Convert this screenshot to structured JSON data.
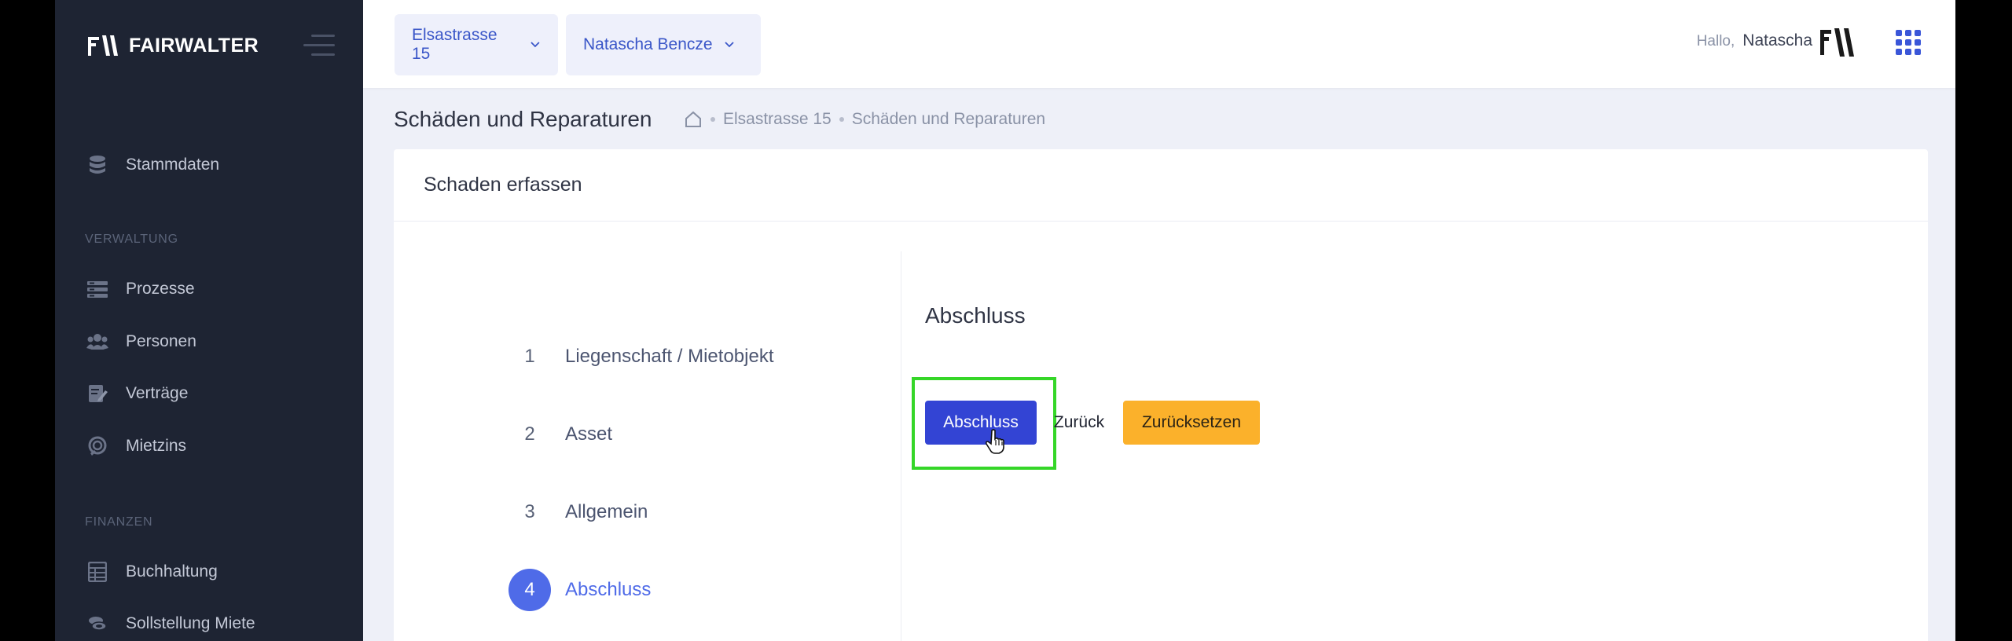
{
  "brand": {
    "name": "FAIRWALTER"
  },
  "sidebar": {
    "items": [
      {
        "label": "Stammdaten",
        "icon": "database-icon"
      },
      {
        "label": "Prozesse",
        "icon": "list-icon"
      },
      {
        "label": "Personen",
        "icon": "users-icon"
      },
      {
        "label": "Verträge",
        "icon": "contract-icon"
      },
      {
        "label": "Mietzins",
        "icon": "rent-icon"
      },
      {
        "label": "Buchhaltung",
        "icon": "ledger-icon"
      },
      {
        "label": "Sollstellung Miete",
        "icon": "coins-icon"
      }
    ],
    "sections": {
      "verwaltung": "VERWALTUNG",
      "finanzen": "FINANZEN"
    }
  },
  "header": {
    "property_select": "Elsastrasse 15",
    "person_select": "Natascha Bencze",
    "greeting": "Hallo,",
    "user_name": "Natascha"
  },
  "page": {
    "title": "Schäden und Reparaturen",
    "breadcrumb": [
      "Elsastrasse 15",
      "Schäden und Reparaturen"
    ]
  },
  "card": {
    "title": "Schaden erfassen"
  },
  "steps": [
    {
      "num": "1",
      "label": "Liegenschaft / Mietobjekt"
    },
    {
      "num": "2",
      "label": "Asset"
    },
    {
      "num": "3",
      "label": "Allgemein"
    },
    {
      "num": "4",
      "label": "Abschluss"
    }
  ],
  "content": {
    "section_title": "Abschluss",
    "btn_finish": "Abschluss",
    "btn_back": "Zurück",
    "btn_reset": "Zurücksetzen"
  },
  "colors": {
    "sidebar_bg": "#1e2433",
    "accent": "#4f6be8",
    "primary_button": "#3344d4",
    "warning_button": "#fbb12b",
    "highlight": "#35d628"
  }
}
